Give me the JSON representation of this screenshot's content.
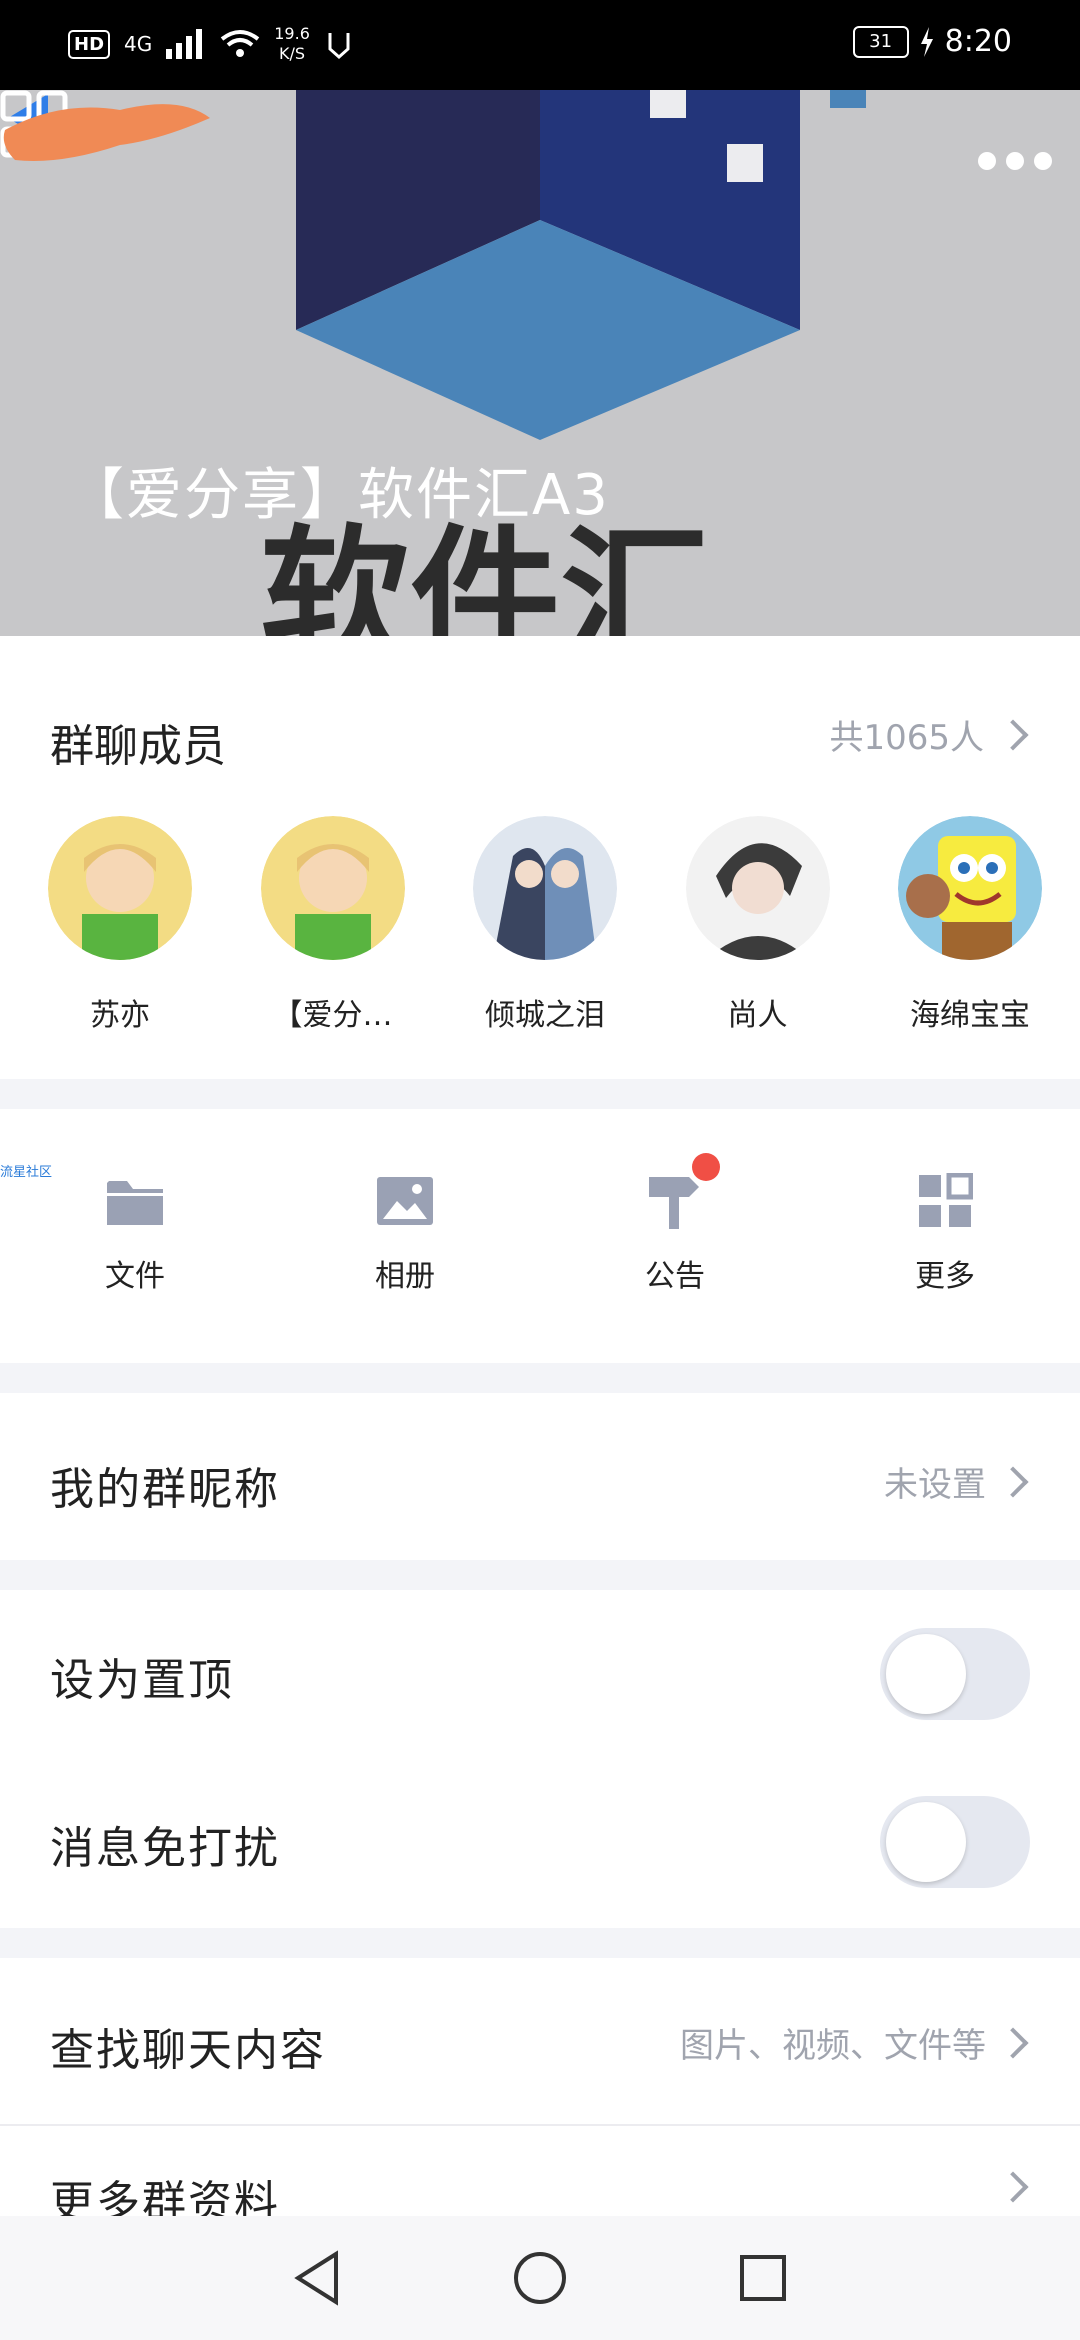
{
  "status_bar": {
    "network_hd": "HD",
    "network_type": "4G",
    "speed_value": "19.6",
    "speed_unit": "K/S",
    "battery": "31",
    "time": "8:20"
  },
  "header": {
    "group_title": "【爱分享】软件汇A3",
    "icons": [
      "back-arrow-icon",
      "more-dots-icon",
      "qr-code-icon"
    ]
  },
  "members": {
    "title": "群聊成员",
    "count": "共1065人",
    "list": [
      {
        "name": "苏亦"
      },
      {
        "name": "【爱分…"
      },
      {
        "name": "倾城之泪"
      },
      {
        "name": "尚人"
      },
      {
        "name": "海绵宝宝"
      }
    ]
  },
  "watermark": "流星社区",
  "tools": [
    {
      "label": "文件",
      "icon": "folder-icon"
    },
    {
      "label": "相册",
      "icon": "image-icon"
    },
    {
      "label": "公告",
      "icon": "signpost-icon"
    },
    {
      "label": "更多",
      "icon": "grid-icon"
    }
  ],
  "settings": {
    "nickname_label": "我的群昵称",
    "nickname_value": "未设置",
    "pin_label": "设为置顶",
    "pin_on": false,
    "mute_label": "消息免打扰",
    "mute_on": false,
    "search_label": "查找聊天内容",
    "search_value": "图片、视频、文件等",
    "more_info_label": "更多群资料"
  },
  "colors": {
    "accent_blue": "#1f6fe0",
    "red_badge": "#f04f45",
    "secondary_text": "#a0a4ae"
  }
}
